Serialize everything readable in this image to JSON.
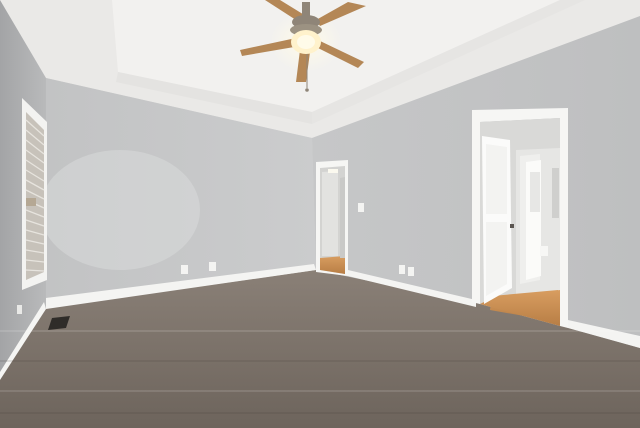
{
  "scene": {
    "kind": "photo",
    "subject": "empty-bedroom",
    "palette": {
      "ceiling": "#ecebe9",
      "tray_ceiling": "#f1f0ee",
      "wall_left": "#aeafb0",
      "wall_back": "#c6c7c8",
      "wall_right": "#c3c4c5",
      "trim": "#f6f6f4",
      "carpet": "#7a7068",
      "carpet_light": "#8c8279",
      "hall_floor": "#c98f55",
      "hall_wall": "#d6d6d4",
      "fan_blade": "#b6885a",
      "fan_metal": "#8f8578",
      "fan_light": "#fff4d2"
    },
    "icons": [
      "ceiling-fan-icon",
      "window-blinds-icon",
      "door-icon",
      "floor-vent-icon",
      "outlet-icon",
      "light-switch-icon"
    ]
  }
}
